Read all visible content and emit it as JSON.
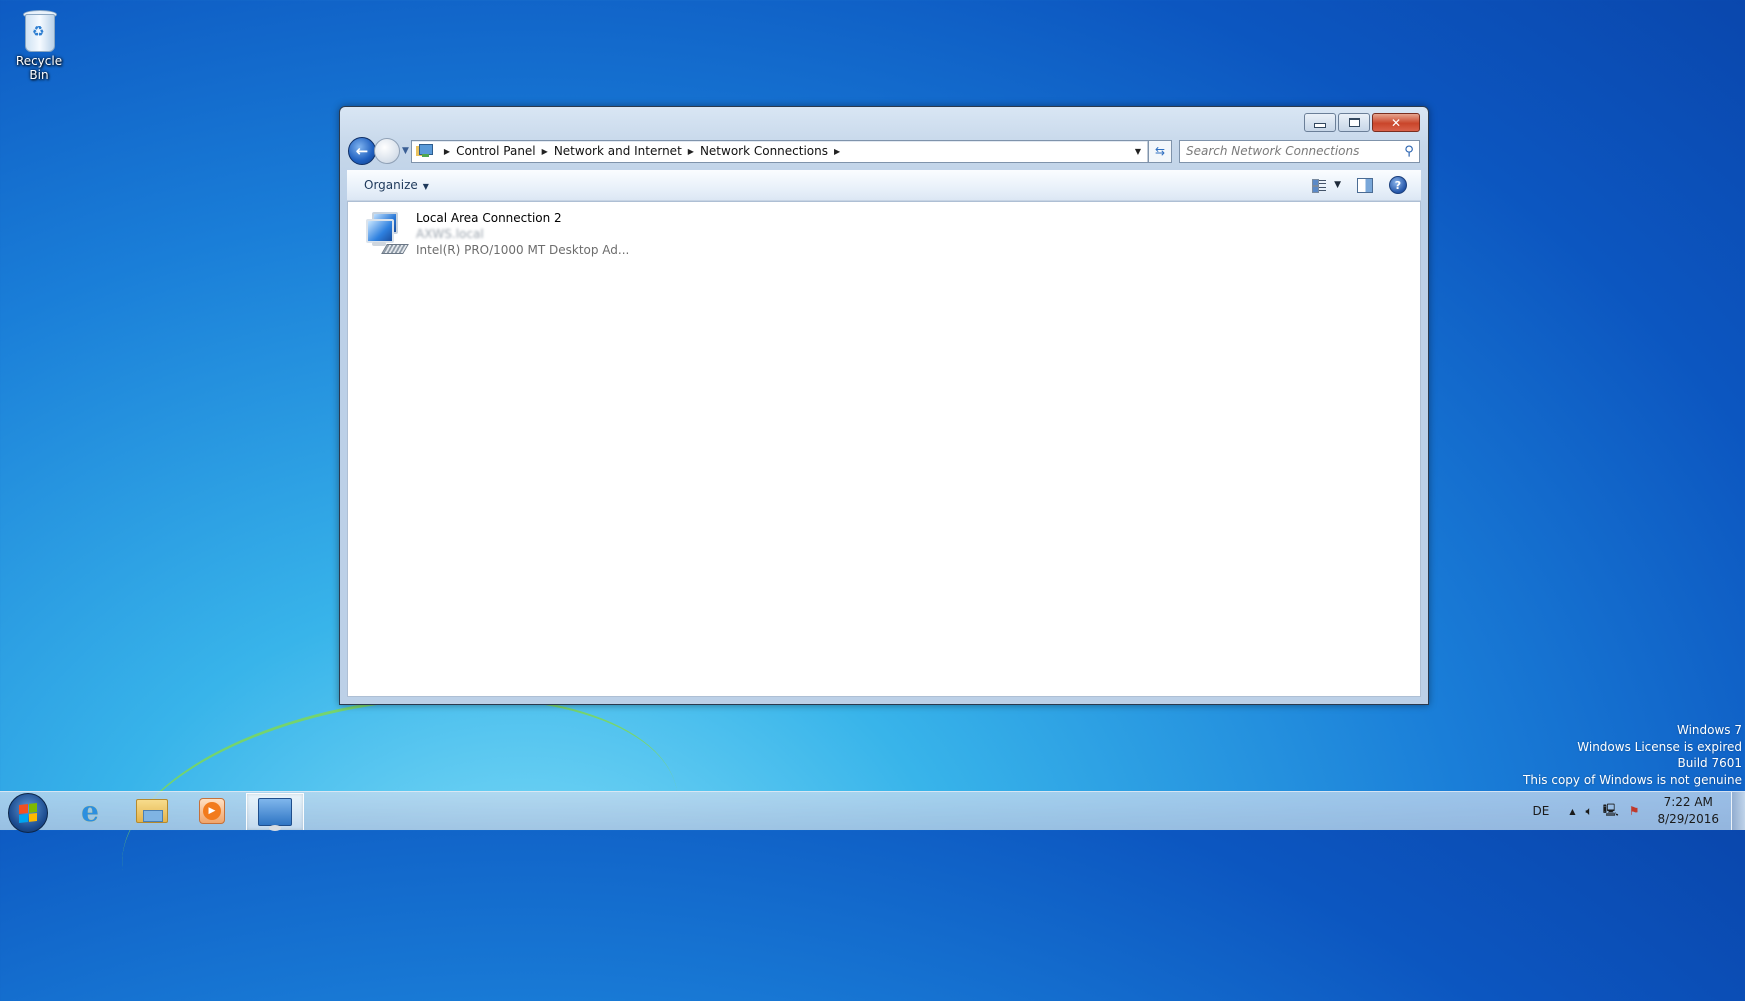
{
  "desktop": {
    "icons": [
      {
        "label": "Recycle Bin",
        "icon": "recycle-bin-icon"
      }
    ],
    "watermark": [
      "Windows 7",
      "Windows License is expired",
      "Build 7601",
      "This copy of Windows is not genuine"
    ]
  },
  "window": {
    "title_buttons": {
      "minimize": "minimize",
      "maximize": "maximize",
      "close": "close"
    },
    "nav": {
      "back_icon": "back-arrow-icon",
      "forward_icon": "forward-arrow-icon",
      "history_icon": "chevron-down-icon"
    },
    "breadcrumb": [
      "Control Panel",
      "Network and Internet",
      "Network Connections"
    ],
    "search": {
      "placeholder": "Search Network Connections",
      "value": ""
    },
    "command_bar": {
      "organize_label": "Organize"
    },
    "connections": [
      {
        "name": "Local Area Connection 2",
        "status": "AXWS.local",
        "adapter": "Intel(R) PRO/1000 MT Desktop Ad..."
      }
    ]
  },
  "taskbar": {
    "apps": [
      {
        "name": "Internet Explorer",
        "icon": "internet-explorer-icon",
        "active": false
      },
      {
        "name": "Windows Explorer",
        "icon": "folder-icon",
        "active": false
      },
      {
        "name": "Windows Media Player",
        "icon": "media-player-icon",
        "active": false
      },
      {
        "name": "Control Panel",
        "icon": "control-panel-icon",
        "active": true
      }
    ],
    "language": "DE",
    "tray_up_arrow": "▲",
    "clock": {
      "time": "7:22 AM",
      "date": "8/29/2016"
    }
  },
  "colors": {
    "close_button": "#c9452a",
    "accent": "#2a63b0"
  }
}
